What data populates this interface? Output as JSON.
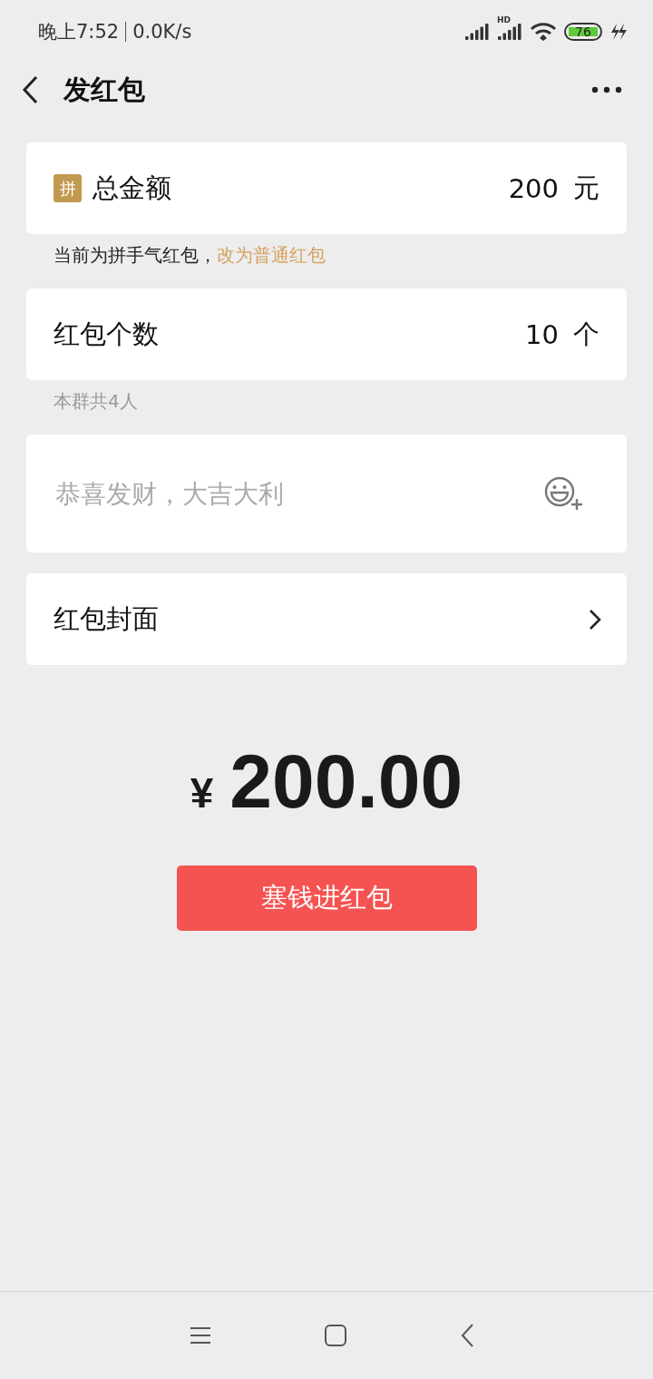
{
  "status_bar": {
    "time": "晚上7:52",
    "speed": "0.0K/s",
    "network_label": "HD",
    "battery": "76"
  },
  "header": {
    "title": "发红包"
  },
  "amount": {
    "badge": "拼",
    "label": "总金额",
    "value": "200",
    "unit": "元"
  },
  "amount_note": {
    "text": "当前为拼手气红包，",
    "link": "改为普通红包"
  },
  "count": {
    "label": "红包个数",
    "value": "10",
    "unit": "个"
  },
  "count_note": "本群共4人",
  "message": {
    "placeholder": "恭喜发财，大吉大利"
  },
  "cover": {
    "label": "红包封面"
  },
  "total": {
    "currency": "¥",
    "amount": "200.00"
  },
  "submit_button": "塞钱进红包"
}
